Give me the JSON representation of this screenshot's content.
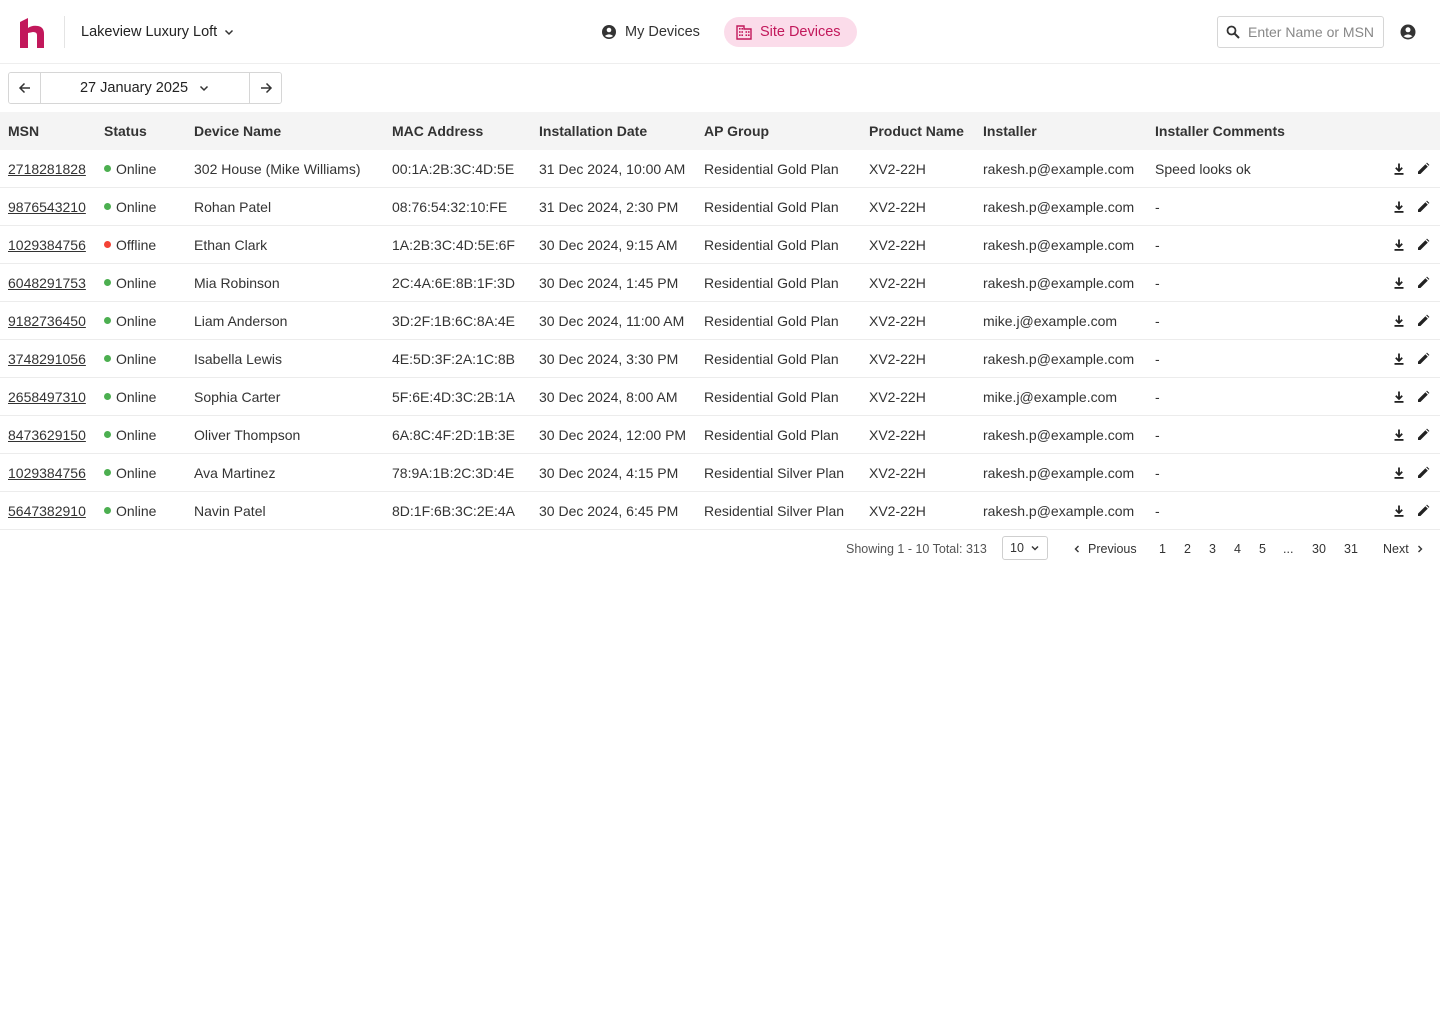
{
  "header": {
    "site_name": "Lakeview Luxury Loft",
    "tabs": [
      {
        "label": "My Devices",
        "icon": "account-circle-icon",
        "active": false
      },
      {
        "label": "Site Devices",
        "icon": "building-icon",
        "active": true
      }
    ],
    "search_placeholder": "Enter Name or MSN"
  },
  "date_nav": {
    "date": "27 January 2025"
  },
  "table": {
    "columns": [
      "MSN",
      "Status",
      "Device Name",
      "MAC Address",
      "Installation Date",
      "AP Group",
      "Product Name",
      "Installer",
      "Installer Comments"
    ],
    "rows": [
      {
        "msn": "2718281828",
        "status": "Online",
        "name": "302 House (Mike Williams)",
        "mac": "00:1A:2B:3C:4D:5E",
        "date": "31 Dec 2024, 10:00 AM",
        "ap": "Residential Gold Plan",
        "product": "XV2-22H",
        "installer": "rakesh.p@example.com",
        "comment": "Speed looks ok"
      },
      {
        "msn": "9876543210",
        "status": "Online",
        "name": "Rohan Patel",
        "mac": "08:76:54:32:10:FE",
        "date": "31 Dec 2024, 2:30 PM",
        "ap": "Residential Gold Plan",
        "product": "XV2-22H",
        "installer": "rakesh.p@example.com",
        "comment": "-"
      },
      {
        "msn": "1029384756",
        "status": "Offline",
        "name": "Ethan Clark",
        "mac": "1A:2B:3C:4D:5E:6F",
        "date": "30 Dec 2024, 9:15 AM",
        "ap": "Residential Gold Plan",
        "product": "XV2-22H",
        "installer": "rakesh.p@example.com",
        "comment": "-"
      },
      {
        "msn": "6048291753",
        "status": "Online",
        "name": "Mia Robinson",
        "mac": "2C:4A:6E:8B:1F:3D",
        "date": "30 Dec 2024, 1:45 PM",
        "ap": "Residential Gold Plan",
        "product": "XV2-22H",
        "installer": "rakesh.p@example.com",
        "comment": "-"
      },
      {
        "msn": "9182736450",
        "status": "Online",
        "name": "Liam Anderson",
        "mac": "3D:2F:1B:6C:8A:4E",
        "date": "30 Dec 2024, 11:00 AM",
        "ap": "Residential Gold Plan",
        "product": "XV2-22H",
        "installer": "mike.j@example.com",
        "comment": "-"
      },
      {
        "msn": "3748291056",
        "status": "Online",
        "name": "Isabella Lewis",
        "mac": "4E:5D:3F:2A:1C:8B",
        "date": "30 Dec 2024, 3:30 PM",
        "ap": "Residential Gold Plan",
        "product": "XV2-22H",
        "installer": "rakesh.p@example.com",
        "comment": "-"
      },
      {
        "msn": "2658497310",
        "status": "Online",
        "name": "Sophia Carter",
        "mac": "5F:6E:4D:3C:2B:1A",
        "date": "30 Dec 2024, 8:00 AM",
        "ap": "Residential Gold Plan",
        "product": "XV2-22H",
        "installer": "mike.j@example.com",
        "comment": "-"
      },
      {
        "msn": "8473629150",
        "status": "Online",
        "name": "Oliver Thompson",
        "mac": "6A:8C:4F:2D:1B:3E",
        "date": "30 Dec 2024, 12:00 PM",
        "ap": "Residential Gold Plan",
        "product": "XV2-22H",
        "installer": "rakesh.p@example.com",
        "comment": "-"
      },
      {
        "msn": "1029384756",
        "status": "Online",
        "name": "Ava Martinez",
        "mac": "78:9A:1B:2C:3D:4E",
        "date": "30 Dec 2024, 4:15 PM",
        "ap": "Residential Silver Plan",
        "product": "XV2-22H",
        "installer": "rakesh.p@example.com",
        "comment": "-"
      },
      {
        "msn": "5647382910",
        "status": "Online",
        "name": "Navin Patel",
        "mac": "8D:1F:6B:3C:2E:4A",
        "date": "30 Dec 2024, 6:45 PM",
        "ap": "Residential Silver Plan",
        "product": "XV2-22H",
        "installer": "rakesh.p@example.com",
        "comment": "-"
      }
    ],
    "row_actions": [
      "download-icon",
      "edit-icon"
    ]
  },
  "pagination": {
    "showing": "Showing 1 - 10 Total: 313",
    "page_size": "10",
    "previous": "Previous",
    "next": "Next",
    "pages": [
      "1",
      "2",
      "3",
      "4",
      "5",
      "...",
      "30",
      "31"
    ]
  },
  "colors": {
    "brand": "#c2185b",
    "active_tab_bg": "#fbdcea",
    "online": "#4caf50",
    "offline": "#f44336",
    "header_row_bg": "#f4f4f4"
  }
}
